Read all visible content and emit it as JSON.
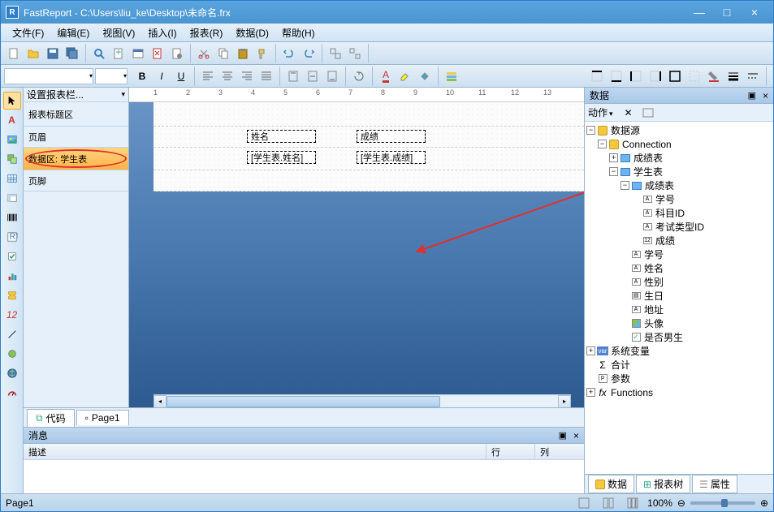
{
  "title": {
    "app": "FastReport",
    "path": "C:\\Users\\liu_ke\\Desktop\\未命名.frx"
  },
  "menu": {
    "file": "文件(F)",
    "edit": "编辑(E)",
    "view": "视图(V)",
    "insert": "插入(I)",
    "report": "报表(R)",
    "data": "数据(D)",
    "help": "帮助(H)"
  },
  "bands": {
    "configure": "设置报表栏...",
    "title": "报表标题区",
    "header": "页眉",
    "data": "数据区: 学生表",
    "footer": "页脚"
  },
  "fields": {
    "name_label": "姓名",
    "score_label": "成绩",
    "name_expr": "[学生表.姓名]",
    "score_expr": "[学生表.成绩]"
  },
  "tabs": {
    "code": "代码",
    "page1": "Page1"
  },
  "data_panel": {
    "title": "数据",
    "actions": "动作",
    "root": "数据源",
    "connection": "Connection",
    "table_scores": "成绩表",
    "table_students": "学生表",
    "sub_scores": "成绩表",
    "fields": {
      "student_id": "学号",
      "subject_id": "科目ID",
      "exam_type_id": "考试类型ID",
      "score": "成绩",
      "name": "姓名",
      "gender": "性别",
      "birthday": "生日",
      "address": "地址",
      "avatar": "头像",
      "is_male": "是否男生"
    },
    "sys_vars": "系统变量",
    "totals": "合计",
    "params": "参数",
    "functions": "Functions"
  },
  "panel_tabs": {
    "data": "数据",
    "report_tree": "报表树",
    "properties": "属性"
  },
  "messages": {
    "title": "消息",
    "desc": "描述",
    "row": "行",
    "col": "列"
  },
  "status": {
    "page": "Page1",
    "zoom": "100%"
  },
  "ruler_ticks": [
    1,
    2,
    3,
    4,
    5,
    6,
    7,
    8,
    9,
    10,
    11,
    12,
    13
  ]
}
